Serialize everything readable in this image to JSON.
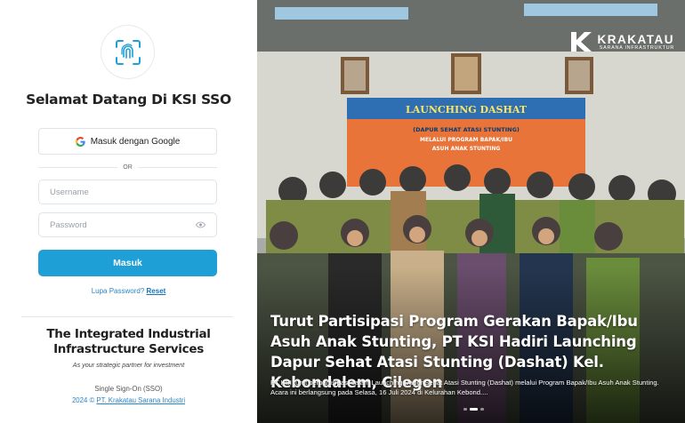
{
  "login": {
    "title": "Selamat Datang Di KSI SSO",
    "google_button": "Masuk dengan Google",
    "or_label": "OR",
    "username_placeholder": "Username",
    "password_placeholder": "Password",
    "submit_label": "Masuk",
    "forgot_text": "Lupa Password?",
    "reset_link": "Reset"
  },
  "footer": {
    "tagline_line1": "The Integrated Industrial",
    "tagline_line2": "Infrastructure Services",
    "subtagline": "As your strategic partner for investment",
    "sso_label": "Single Sign-On (SSO)",
    "copyright_prefix": "2024 ©",
    "company_link": "PT. Krakatau Sarana Industri"
  },
  "slide": {
    "brand_name": "KRAKATAU",
    "brand_subtitle": "SARANA INFRASTRUKTUR",
    "banner_title": "LAUNCHING DASHAT",
    "banner_line1": "(DAPUR SEHAT ATASI STUNTING)",
    "banner_line2": "MELALUI PROGRAM BAPAK/IBU",
    "banner_line3": "ASUH ANAK STUNTING",
    "caption_title": "Turut Partisipasi Program Gerakan Bapak/Ibu Asuh Anak Stunting, PT KSI Hadiri Launching Dapur Sehat Atasi Stunting (Dashat) Kel. Kebondalem, Cilegon",
    "caption_desc": "PT KSI turut berpartisipasi dalam Launching Dapur Sehat Atasi Stunting (Dashat) melalui Program Bapak/Ibu Asuh Anak Stunting. Acara ini berlangsung pada Selasa, 16 Juli 2024 di Kelurahan Kebond....",
    "active_slide": 2,
    "slide_count": 3
  },
  "colors": {
    "primary": "#1e9fd6",
    "link": "#2a86c8",
    "title_text": "#222222"
  }
}
